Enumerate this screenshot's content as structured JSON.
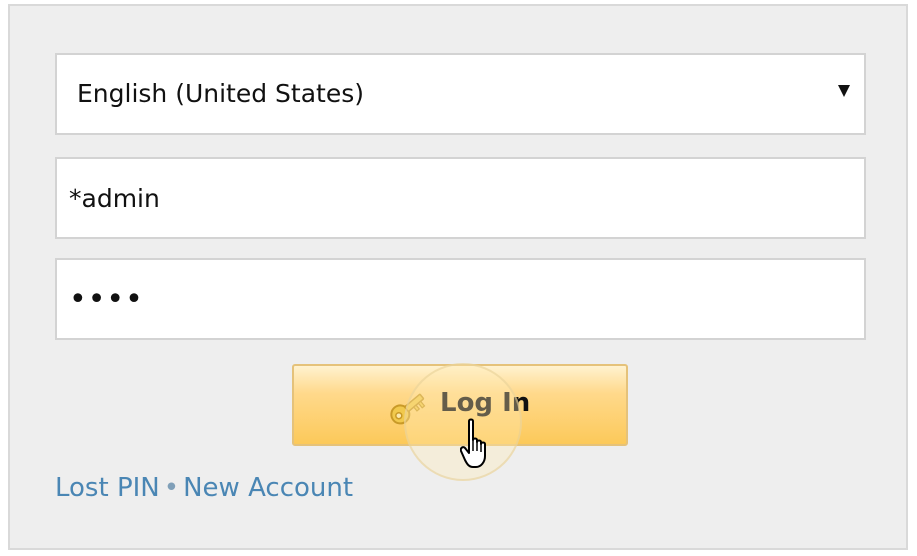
{
  "language_select": {
    "selected": "English (United States)",
    "icon": "chevron-down-icon"
  },
  "username": {
    "value": "*admin"
  },
  "password": {
    "value": "••••"
  },
  "login_button": {
    "label": "Log In",
    "icon": "key-icon",
    "color": "#fcc95a"
  },
  "links": {
    "lost_pin": "Lost PIN",
    "separator": "•",
    "new_account": "New Account",
    "color": "#4a86b4"
  }
}
